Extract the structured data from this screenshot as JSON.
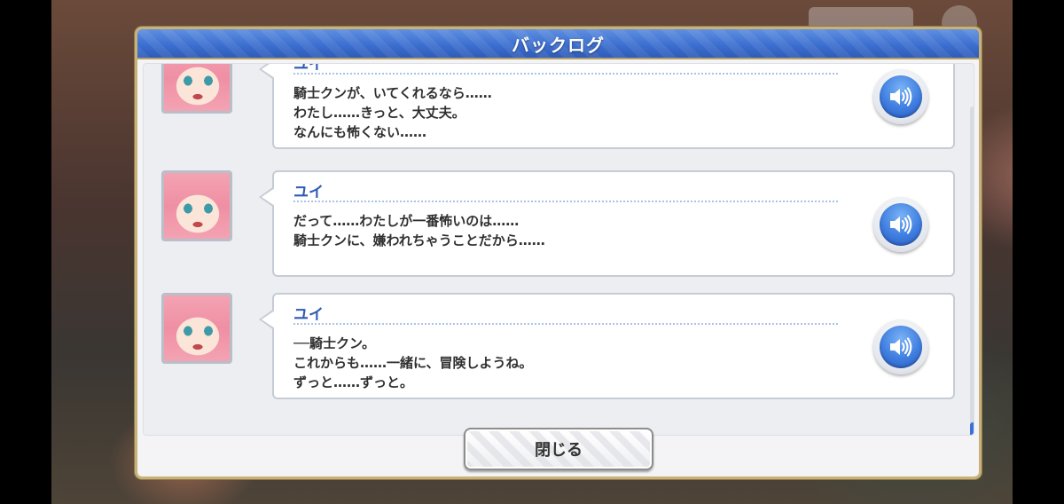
{
  "dialog": {
    "title": "バックログ",
    "close_label": "閉じる"
  },
  "log": [
    {
      "speaker": "ユイ",
      "lines": [
        "騎士クンが、いてくれるなら……",
        "わたし……きっと、大丈夫。",
        "なんにも怖くない……"
      ],
      "voice_icon": "speaker-icon"
    },
    {
      "speaker": "ユイ",
      "lines": [
        "だって……わたしが一番怖いのは……",
        "騎士クンに、嫌われちゃうことだから……"
      ],
      "voice_icon": "speaker-icon"
    },
    {
      "speaker": "ユイ",
      "lines": [
        "──騎士クン。",
        "これからも……一緒に、冒険しようね。",
        "ずっと……ずっと。"
      ],
      "voice_icon": "speaker-icon"
    }
  ],
  "colors": {
    "title_bar": "#3c6fd0",
    "speaker_name": "#2f5ab6",
    "voice_button": "#3f7ee0",
    "frame_gold": "#c8b27a"
  }
}
